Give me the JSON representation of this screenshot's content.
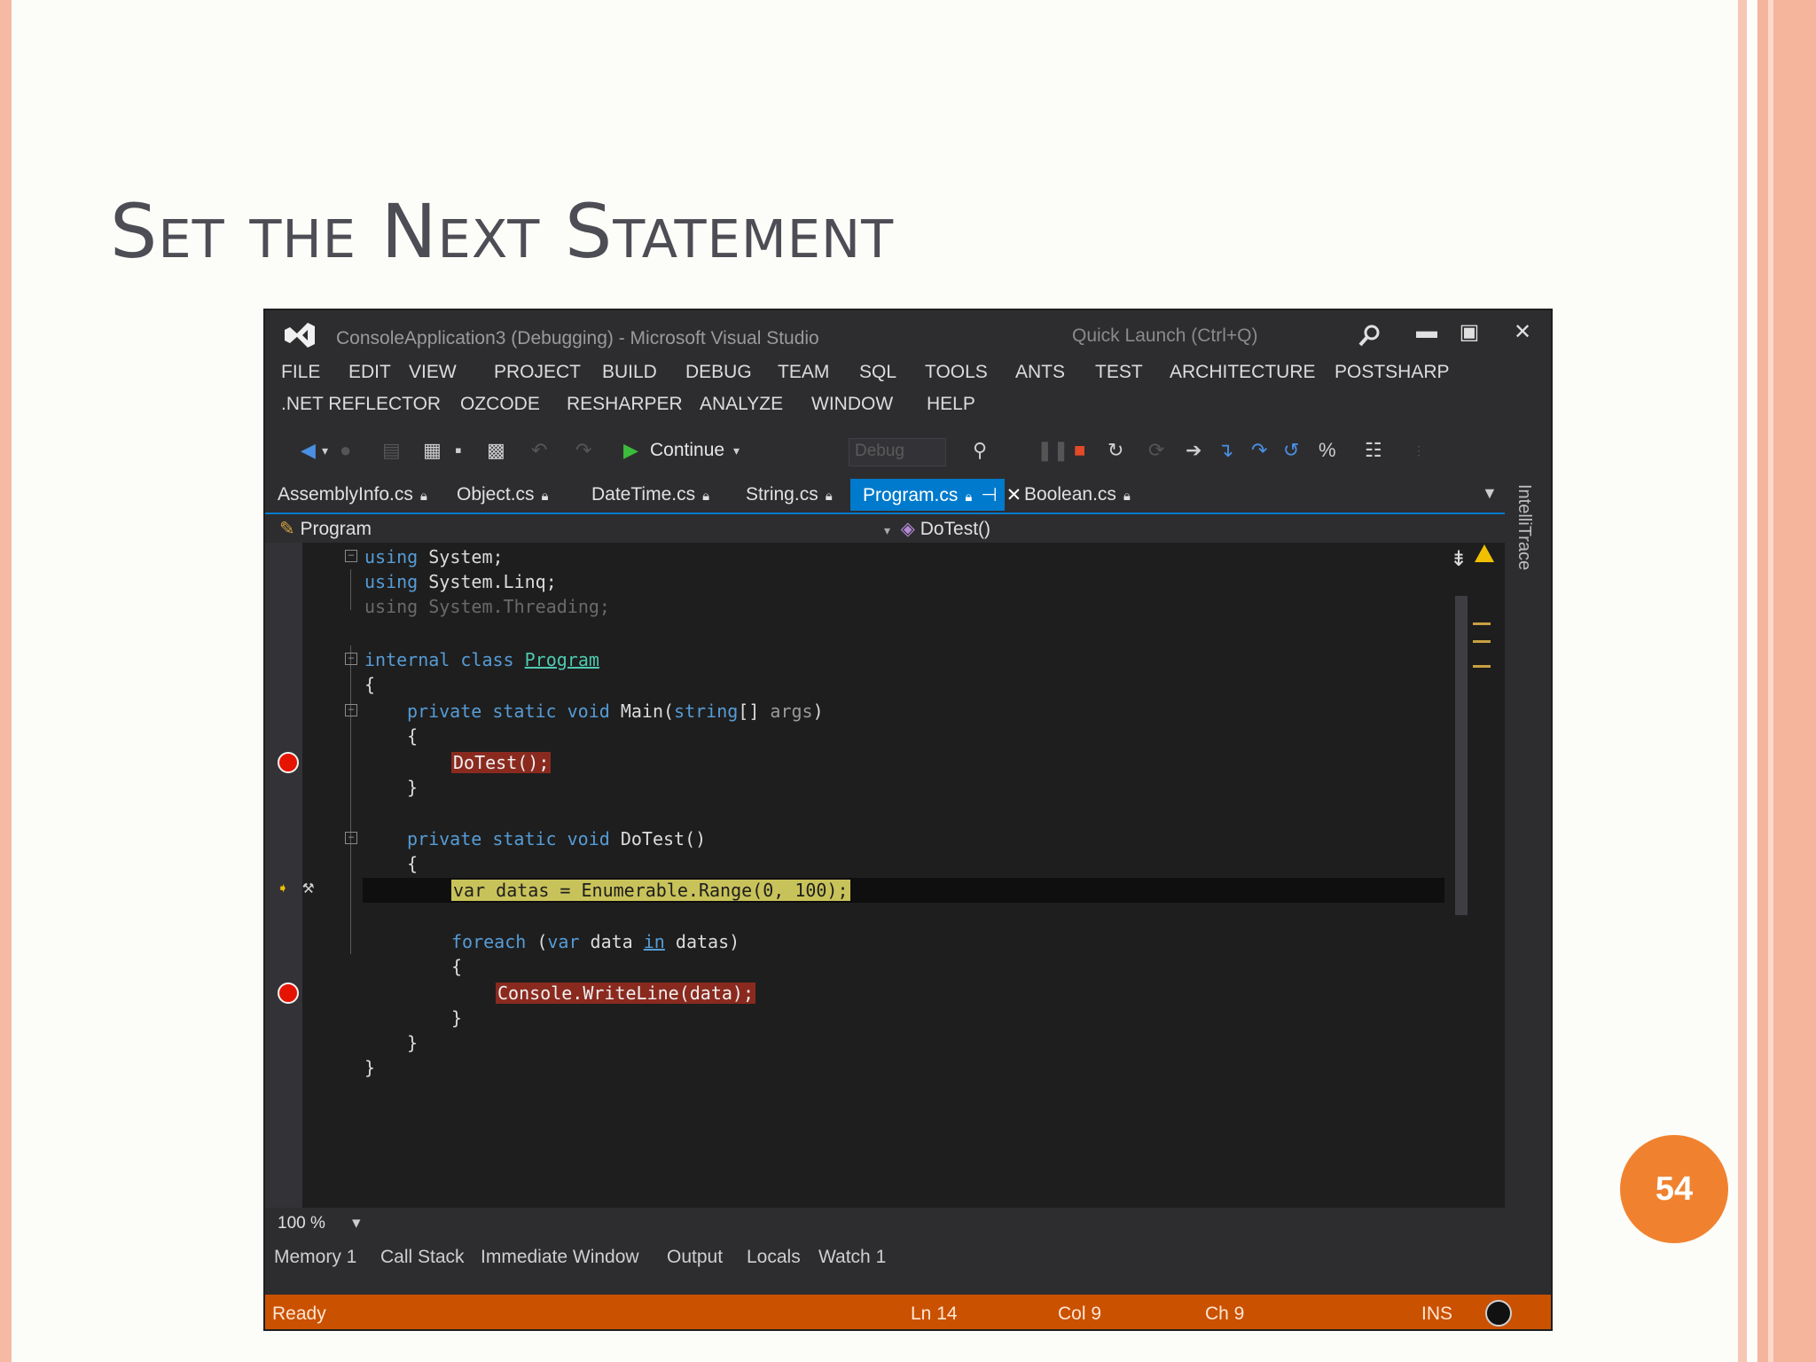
{
  "slide": {
    "title": "Set the Next Statement",
    "page_number": "54"
  },
  "window": {
    "title": "ConsoleApplication3 (Debugging) - Microsoft Visual Studio",
    "quick_launch_placeholder": "Quick Launch (Ctrl+Q)"
  },
  "menu": {
    "row1": [
      "FILE",
      "EDIT",
      "VIEW",
      "PROJECT",
      "BUILD",
      "DEBUG",
      "TEAM",
      "SQL",
      "TOOLS",
      "ANTS",
      "TEST",
      "ARCHITECTURE",
      "POSTSHARP"
    ],
    "row2": [
      ".NET REFLECTOR",
      "OZCODE",
      "RESHARPER",
      "ANALYZE",
      "WINDOW",
      "HELP"
    ]
  },
  "toolbar": {
    "continue_label": "Continue",
    "config_value": "Debug"
  },
  "tabs": [
    {
      "label": "AssemblyInfo.cs"
    },
    {
      "label": "Object.cs"
    },
    {
      "label": "DateTime.cs"
    },
    {
      "label": "String.cs"
    },
    {
      "label": "Program.cs"
    },
    {
      "label": "Boolean.cs"
    }
  ],
  "side_panel": {
    "label": "IntelliTrace"
  },
  "navbar": {
    "class_name": "Program",
    "member_name": "DoTest()"
  },
  "code": {
    "l1_kw": "using",
    "l1_rest": " System;",
    "l2_kw": "using",
    "l2_rest": " System.Linq;",
    "l3": "using System.Threading;",
    "l5_kw": "internal class",
    "l5_name": "Program",
    "brace_open": "{",
    "l7_kw": "private static void",
    "l7_name": " Main(",
    "l7_type": "string",
    "l7_rest": "[] ",
    "l7_arg": "args",
    "l7_end": ")",
    "l9": "DoTest();",
    "brace_close": "}",
    "l12_kw": "private static void",
    "l12_rest": " DoTest()",
    "l14": "var datas = Enumerable.Range(0, 100);",
    "l16_kw": "foreach",
    "l16_a": " (",
    "l16_var": "var",
    "l16_b": " data ",
    "l16_in": "in",
    "l16_c": " datas)",
    "l18": "Console.WriteLine(data);"
  },
  "zoom": {
    "value": "100 %"
  },
  "bottom_tabs": [
    "Memory 1",
    "Call Stack",
    "Immediate Window",
    "Output",
    "Locals",
    "Watch 1"
  ],
  "status": {
    "state": "Ready",
    "line": "Ln 14",
    "col": "Col 9",
    "ch": "Ch 9",
    "mode": "INS"
  },
  "colors": {
    "accent": "#007acc",
    "status_bar": "#ca5100",
    "breakpoint": "#e51400",
    "page_badge": "#f0822f"
  }
}
